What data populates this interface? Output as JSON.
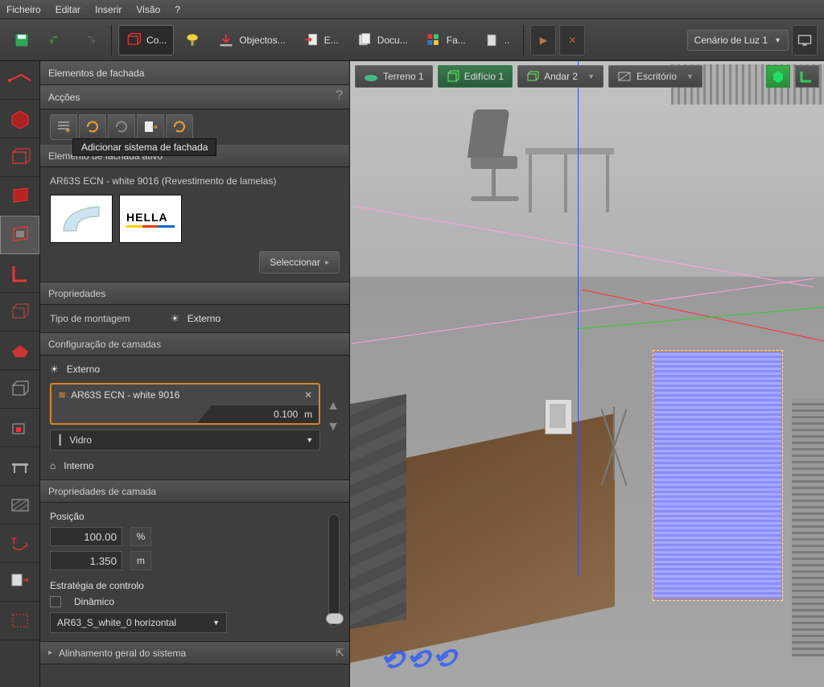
{
  "menubar": {
    "file": "Ficheiro",
    "edit": "Editar",
    "insert": "Inserir",
    "view": "Visão",
    "help": "?"
  },
  "toolbar": {
    "co": "Co...",
    "obj": "Objectos...",
    "e": "E...",
    "docu": "Docu...",
    "fa": "Fa...",
    "scenario": "Cenário de Luz 1"
  },
  "tooltip_add": "Adicionar sistema de fachada",
  "panel": {
    "title": "Elementos de fachada",
    "actions": "Acções",
    "active_head": "Elemento de fachada ativo",
    "active_name": "AR63S ECN - white 9016 (Revestimento de lamelas)",
    "brand": "HELLA",
    "select": "Seleccionar",
    "props": "Propriedades",
    "mount_type": "Tipo de montagem",
    "externo": "Externo",
    "layers_head": "Configuração de camadas",
    "ext2": "Externo",
    "layer_name": "AR63S ECN - white 9016",
    "layer_thickness": "0.100",
    "layer_unit": "m",
    "glass": "Vidro",
    "interno": "Interno",
    "lprops": "Propriedades de camada",
    "posicao": "Posição",
    "pos_pct": "100.00",
    "pos_m": "1.350",
    "pct": "%",
    "m": "m",
    "strategy": "Estratégia de controlo",
    "dynamic": "Dinâmico",
    "strategy_sel": "AR63_S_white_0 horizontal",
    "align": "Alinhamento geral do sistema"
  },
  "crumbs": {
    "terreno": "Terreno 1",
    "edificio": "Edifício 1",
    "andar": "Andar 2",
    "escritorio": "Escritório"
  }
}
